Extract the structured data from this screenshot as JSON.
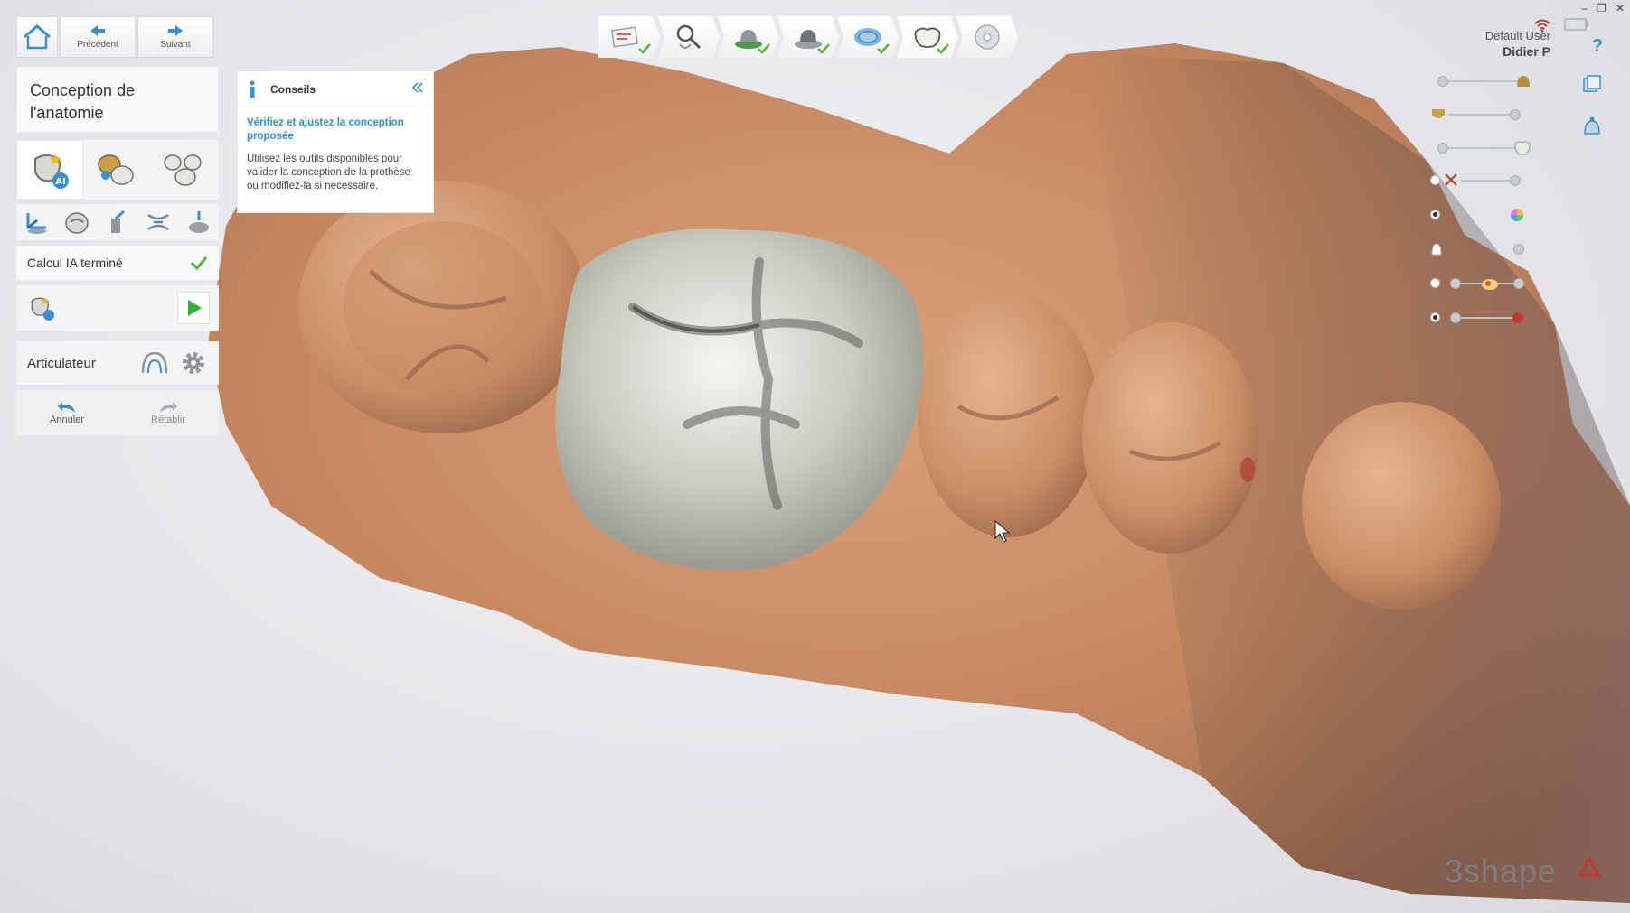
{
  "nav": {
    "previous_label": "Précédent",
    "next_label": "Suivant"
  },
  "panel": {
    "title": "Conception de l'anatomie",
    "ai_status": "Calcul IA terminé",
    "articulator_label": "Articulateur",
    "undo_label": "Annuler",
    "redo_label": "Rétablir"
  },
  "hints": {
    "title": "Conseils",
    "subtitle": "Vérifiez et ajustez la conception proposée",
    "text": "Utilisez les outils disponibles pour valider la conception de la prothèse ou modifiez-la si nécessaire."
  },
  "workflow_steps": [
    "order-form",
    "scan",
    "prep-bottom",
    "prep-top",
    "margin-line",
    "anatomy-design",
    "export"
  ],
  "user": {
    "role": "Default User",
    "name": "Didier P"
  },
  "logo": "3shape",
  "colors": {
    "accent": "#2d8fd5",
    "check": "#59b33b",
    "play": "#2fb036",
    "gum": "#c98b64",
    "crown": "#bfc2b8"
  }
}
